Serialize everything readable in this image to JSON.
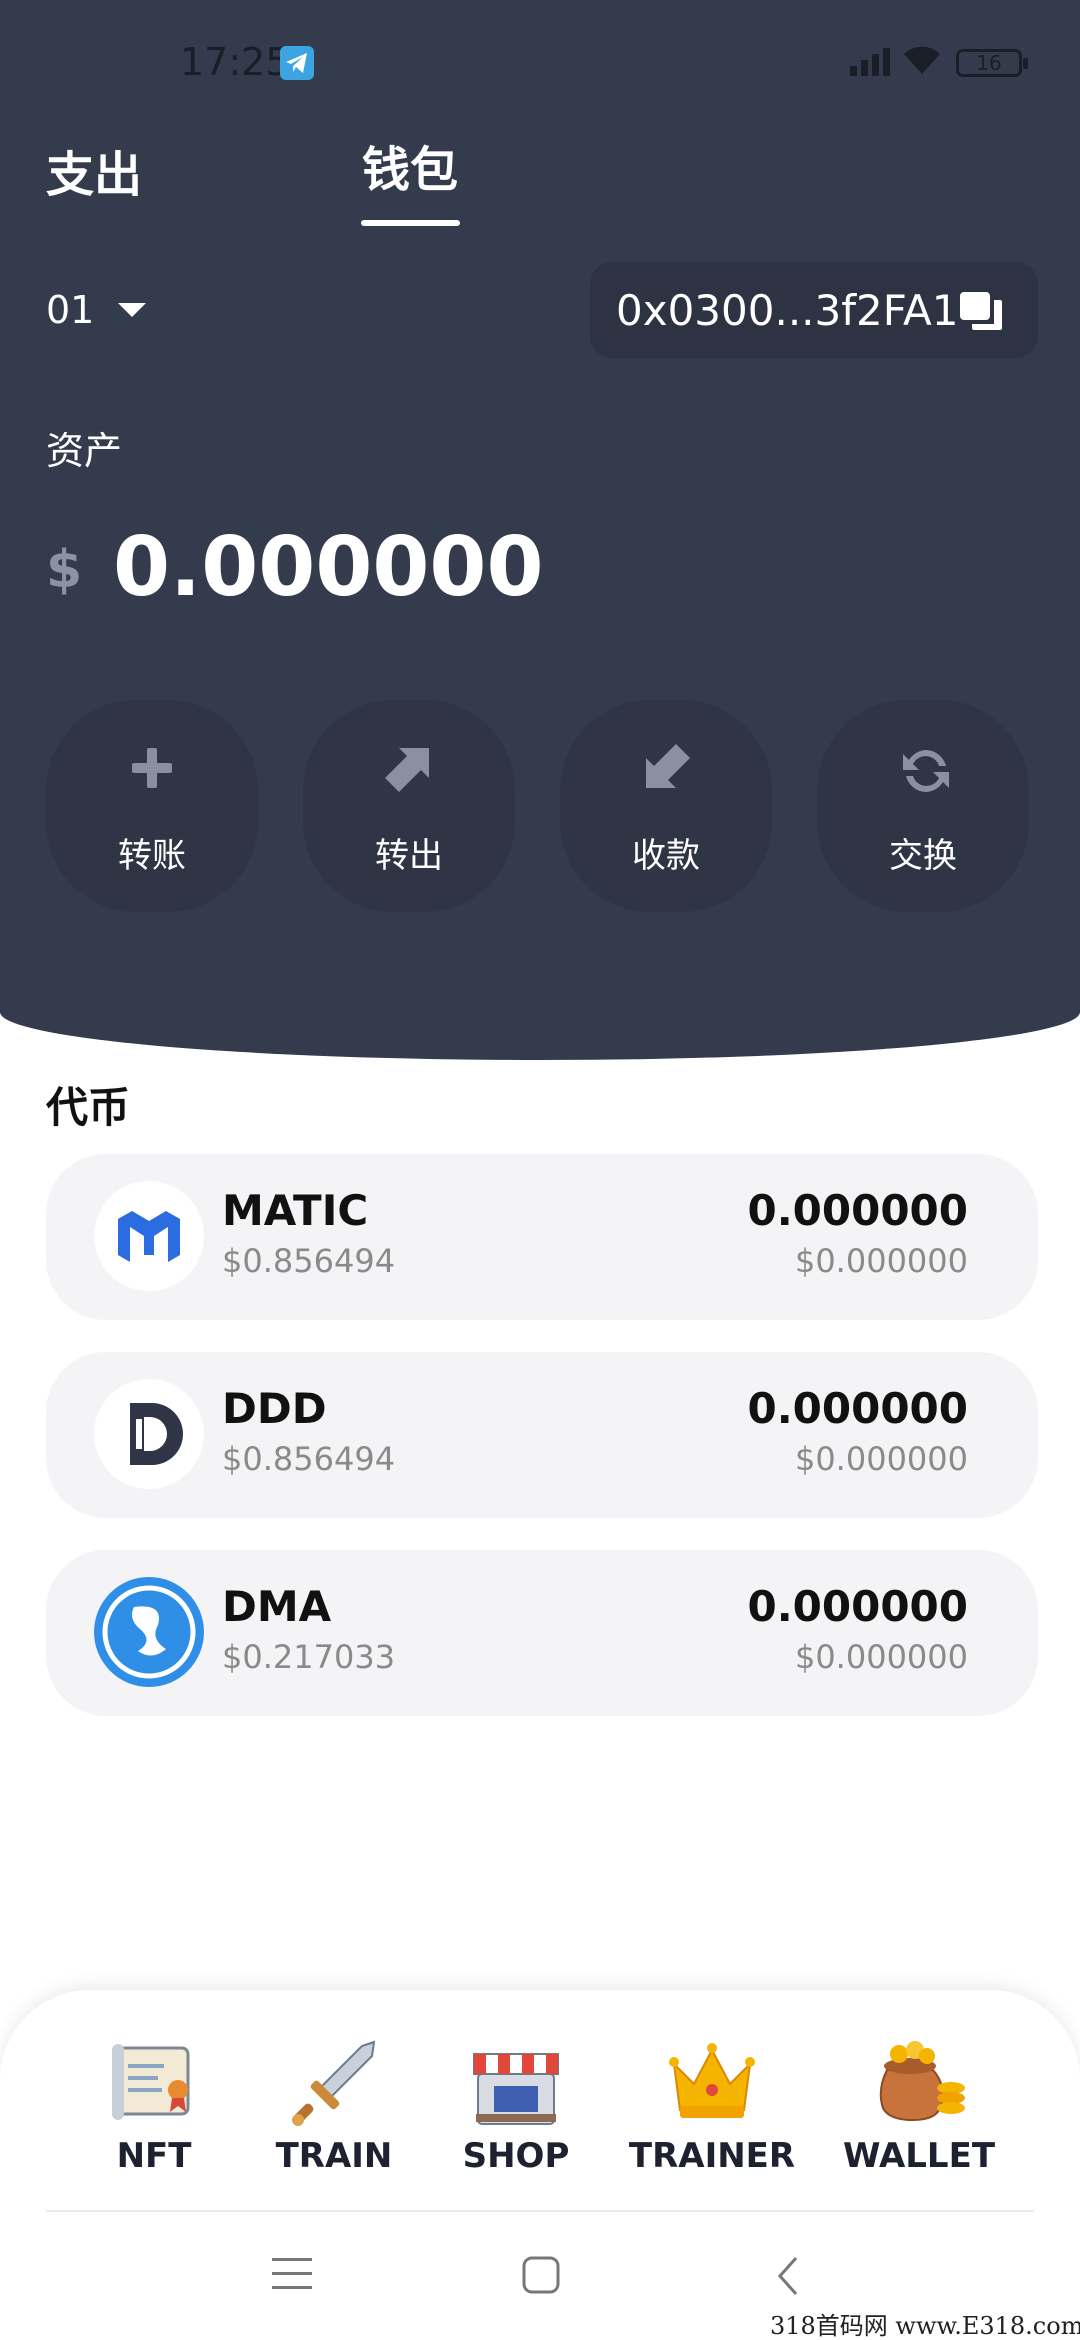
{
  "status_bar": {
    "time": "17:25",
    "battery": "16"
  },
  "tabs": {
    "spend": "支出",
    "wallet": "钱包",
    "active": "wallet"
  },
  "account": {
    "selector": "01",
    "address": "0x0300...3f2FA1"
  },
  "assets": {
    "label": "资产",
    "currency_symbol": "$",
    "balance": "0.000000"
  },
  "actions": [
    {
      "label": "转账",
      "icon": "plus-icon"
    },
    {
      "label": "转出",
      "icon": "arrow-up-right-icon"
    },
    {
      "label": "收款",
      "icon": "arrow-down-left-icon"
    },
    {
      "label": "交换",
      "icon": "refresh-icon"
    }
  ],
  "tokens_section": {
    "title": "代币",
    "items": [
      {
        "name": "MATIC",
        "price": "$0.856494",
        "amount": "0.000000",
        "value": "$0.000000",
        "icon": "matic-logo-icon",
        "color": "#2b6ce0"
      },
      {
        "name": "DDD",
        "price": "$0.856494",
        "amount": "0.000000",
        "value": "$0.000000",
        "icon": "ddd-logo-icon",
        "color": "#2f3547"
      },
      {
        "name": "DMA",
        "price": "$0.217033",
        "amount": "0.000000",
        "value": "$0.000000",
        "icon": "dma-logo-icon",
        "color": "#2f8fe6"
      }
    ]
  },
  "bottom_nav": [
    {
      "label": "NFT",
      "icon": "scroll-certificate-icon"
    },
    {
      "label": "TRAIN",
      "icon": "sword-icon"
    },
    {
      "label": "SHOP",
      "icon": "shop-icon"
    },
    {
      "label": "TRAINER",
      "icon": "crown-icon"
    },
    {
      "label": "WALLET",
      "icon": "money-bag-icon"
    }
  ],
  "watermark": "318首码网 www.E318.com",
  "colors": {
    "header_bg": "#343b4c",
    "action_bg": "#2f3545",
    "card_bg": "#f4f4f6"
  }
}
